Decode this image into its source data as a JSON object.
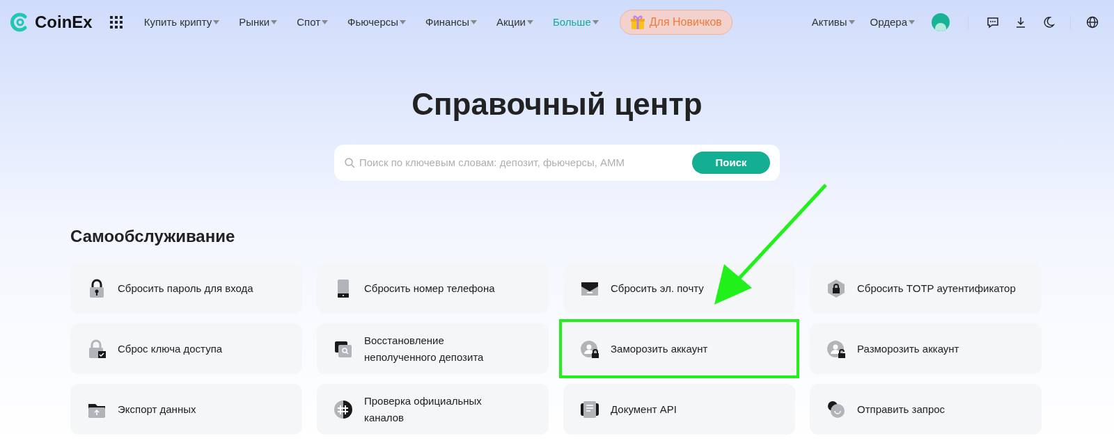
{
  "logo": {
    "text": "CoinEx"
  },
  "nav": [
    {
      "label": "Купить крипту",
      "selected": false
    },
    {
      "label": "Рынки",
      "selected": false
    },
    {
      "label": "Спот",
      "selected": false
    },
    {
      "label": "Фьючерсы",
      "selected": false
    },
    {
      "label": "Финансы",
      "selected": false
    },
    {
      "label": "Акции",
      "selected": false
    },
    {
      "label": "Больше",
      "selected": true
    }
  ],
  "promo": {
    "label": "Для Новичков"
  },
  "nav_right": [
    {
      "label": "Активы"
    },
    {
      "label": "Ордера"
    }
  ],
  "heading": "Справочный центр",
  "search": {
    "placeholder": "Поиск по ключевым словам: депозит, фьючерсы, AMM",
    "button": "Поиск"
  },
  "section": {
    "title": "Самообслуживание",
    "cards": [
      {
        "label": "Сбросить пароль для входа",
        "highlighted": false
      },
      {
        "label": "Сбросить номер телефона",
        "highlighted": false
      },
      {
        "label": "Сбросить эл. почту",
        "highlighted": false
      },
      {
        "label": "Сбросить TOTP аутентификатор",
        "highlighted": false
      },
      {
        "label": "Сброс ключа доступа",
        "highlighted": false
      },
      {
        "label": "Восстановление неполученного депозита",
        "highlighted": false
      },
      {
        "label": "Заморозить аккаунт",
        "highlighted": true
      },
      {
        "label": "Разморозить аккаунт",
        "highlighted": false
      },
      {
        "label": "Экспорт данных",
        "highlighted": false
      },
      {
        "label": "Проверка официальных каналов",
        "highlighted": false
      },
      {
        "label": "Документ API",
        "highlighted": false
      },
      {
        "label": "Отправить запрос",
        "highlighted": false
      }
    ]
  }
}
